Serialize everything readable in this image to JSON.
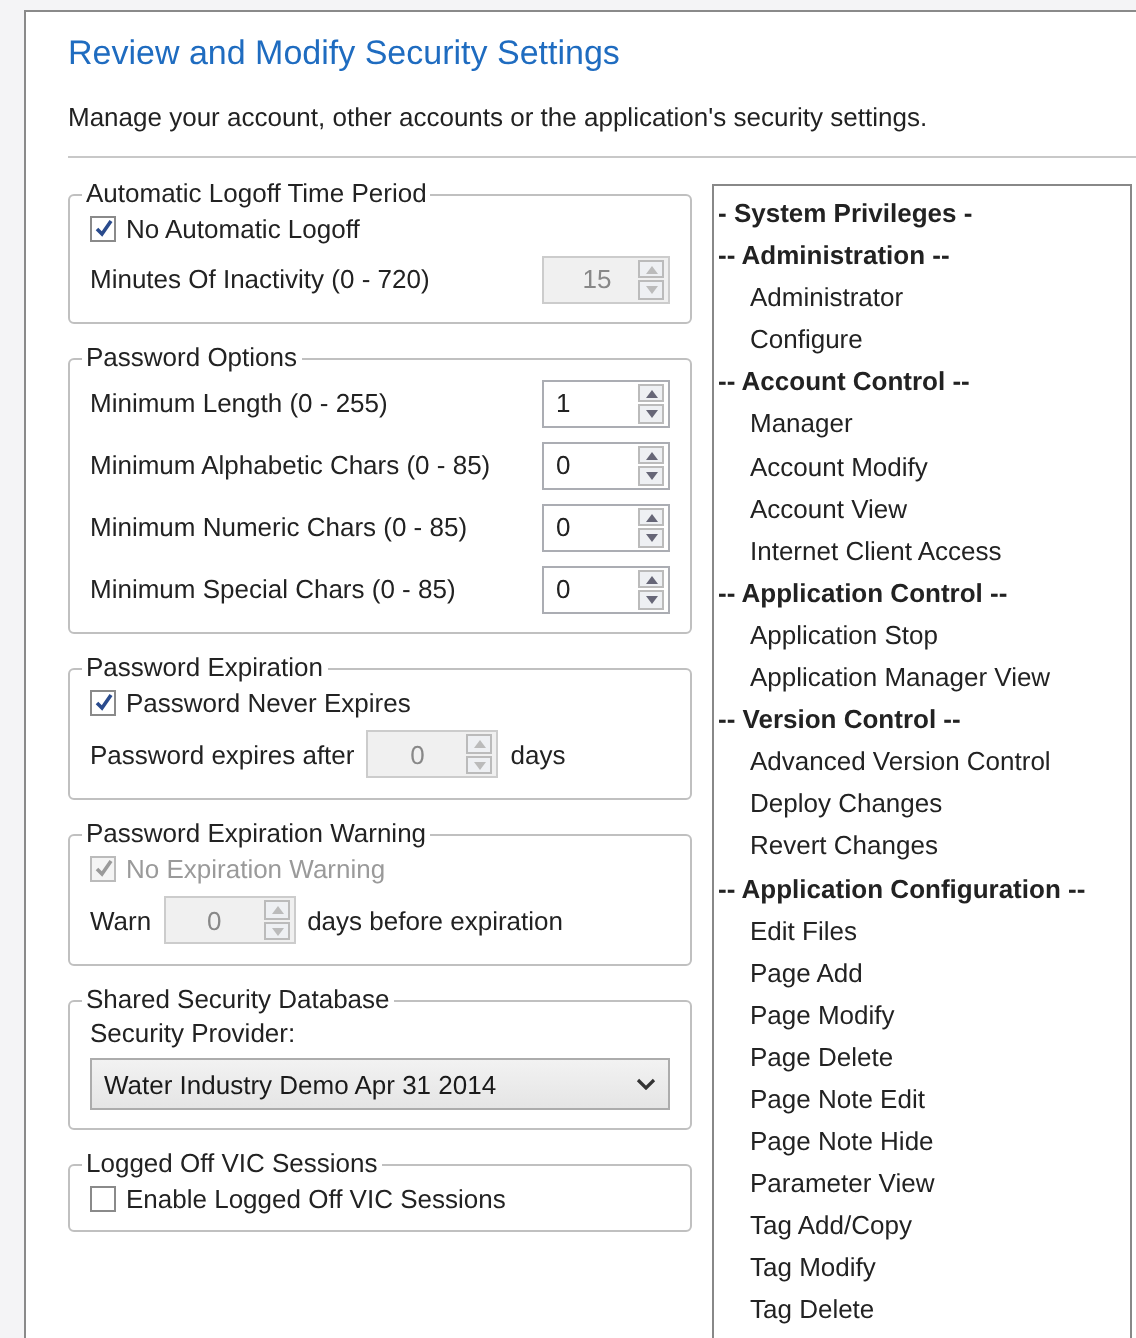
{
  "header": {
    "title": "Review and Modify Security Settings",
    "subtitle": "Manage your account, other accounts or the application's security settings."
  },
  "groups": [
    {
      "legend": "Automatic Logoff Time Period",
      "rows": [
        {
          "kind": "checkbox",
          "label": "No Automatic Logoff",
          "checked": true,
          "disabled": false
        },
        {
          "kind": "spinner",
          "label": "Minutes Of Inactivity (0 - 720)",
          "value": "15",
          "disabled": true
        }
      ]
    },
    {
      "legend": "Password Options",
      "rows": [
        {
          "kind": "spinner",
          "label": "Minimum Length (0 - 255)",
          "value": "1",
          "disabled": false
        },
        {
          "kind": "spinner",
          "label": "Minimum Alphabetic Chars (0 - 85)",
          "value": "0",
          "disabled": false
        },
        {
          "kind": "spinner",
          "label": "Minimum Numeric Chars (0 - 85)",
          "value": "0",
          "disabled": false
        },
        {
          "kind": "spinner",
          "label": "Minimum Special Chars (0 - 85)",
          "value": "0",
          "disabled": false
        }
      ]
    },
    {
      "legend": "Password Expiration",
      "rows": [
        {
          "kind": "checkbox",
          "label": "Password Never Expires",
          "checked": true,
          "disabled": false
        },
        {
          "kind": "inline_spinner",
          "label": "Password expires after",
          "value": "0",
          "unit": "days",
          "disabled": true
        }
      ]
    },
    {
      "legend": "Password Expiration Warning",
      "rows": [
        {
          "kind": "checkbox",
          "label": "No Expiration Warning",
          "checked": true,
          "disabled": true
        },
        {
          "kind": "inline_spinner",
          "label": "Warn",
          "value": "0",
          "unit": "days before expiration",
          "disabled": true
        }
      ]
    },
    {
      "legend": "Shared Security Database",
      "rows": [
        {
          "kind": "label",
          "text": "Security Provider:"
        },
        {
          "kind": "dropdown",
          "value": "Water Industry Demo Apr 31 2014"
        }
      ]
    },
    {
      "legend": "Logged Off VIC Sessions",
      "rows": [
        {
          "kind": "checkbox",
          "label": "Enable Logged Off VIC Sessions",
          "checked": false,
          "disabled": false
        }
      ]
    }
  ],
  "privileges": [
    {
      "kind": "header",
      "text": "- System Privileges -"
    },
    {
      "kind": "header",
      "text": "-- Administration --"
    },
    {
      "kind": "item",
      "text": "Administrator"
    },
    {
      "kind": "item",
      "text": "Configure"
    },
    {
      "kind": "header",
      "text": "-- Account Control --"
    },
    {
      "kind": "item",
      "text": "Manager"
    },
    {
      "kind": "item",
      "text": "Account Modify"
    },
    {
      "kind": "item",
      "text": "Account View"
    },
    {
      "kind": "item",
      "text": "Internet Client Access"
    },
    {
      "kind": "header",
      "text": "-- Application Control --"
    },
    {
      "kind": "item",
      "text": "Application Stop"
    },
    {
      "kind": "item",
      "text": "Application Manager View"
    },
    {
      "kind": "header",
      "text": "-- Version Control --"
    },
    {
      "kind": "item",
      "text": "Advanced Version Control"
    },
    {
      "kind": "item",
      "text": "Deploy Changes"
    },
    {
      "kind": "item",
      "text": "Revert Changes"
    },
    {
      "kind": "header",
      "text": "-- Application Configuration --"
    },
    {
      "kind": "item",
      "text": "Edit Files"
    },
    {
      "kind": "item",
      "text": "Page Add"
    },
    {
      "kind": "item",
      "text": "Page Modify"
    },
    {
      "kind": "item",
      "text": "Page Delete"
    },
    {
      "kind": "item",
      "text": "Page Note Edit"
    },
    {
      "kind": "item",
      "text": "Page Note Hide"
    },
    {
      "kind": "item",
      "text": "Parameter View"
    },
    {
      "kind": "item",
      "text": "Tag Add/Copy"
    },
    {
      "kind": "item",
      "text": "Tag Modify"
    },
    {
      "kind": "item",
      "text": "Tag Delete"
    }
  ]
}
